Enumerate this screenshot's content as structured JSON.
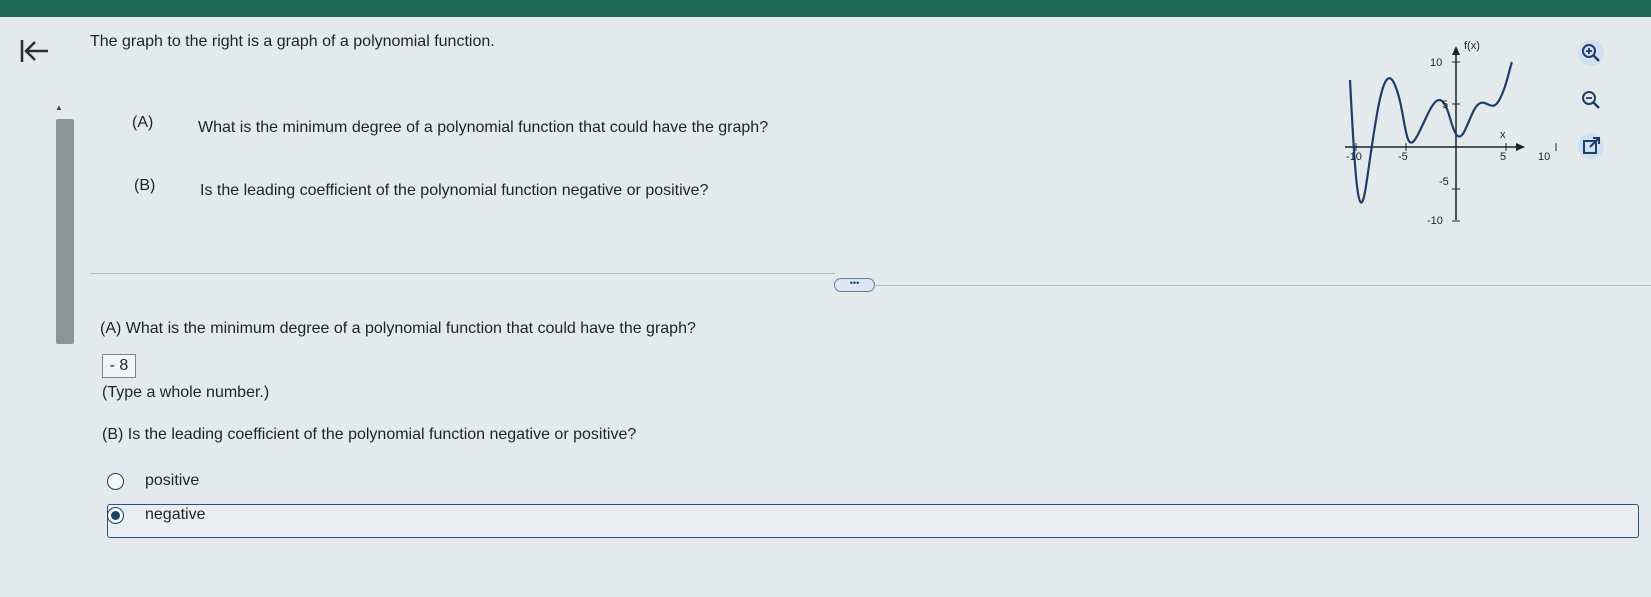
{
  "question": {
    "intro": "The graph to the right is a graph of a polynomial function.",
    "part_a_label": "(A)",
    "part_a_text": "What is the minimum degree of a polynomial function that could have the graph?",
    "part_b_label": "(B)",
    "part_b_text": "Is the leading coefficient of the polynomial function negative or positive?"
  },
  "graph": {
    "y_axis_label": "f(x)",
    "x_axis_label": "x",
    "y_ticks": [
      "10",
      "5",
      "-5",
      "-10"
    ],
    "x_ticks": [
      "-10",
      "-5",
      "5",
      "10"
    ]
  },
  "answers": {
    "a_prompt": "(A) What is the minimum degree of a polynomial function that could have the graph?",
    "a_value": "- 8",
    "a_hint": "(Type a whole number.)",
    "b_prompt": "(B) Is the leading coefficient of the polynomial function negative or positive?",
    "options": [
      "positive",
      "negative"
    ],
    "selected": "negative"
  },
  "icons": {
    "back": "back-arrow-icon",
    "zoom_in": "zoom-in-icon",
    "zoom_out": "zoom-out-icon",
    "popout": "popout-icon"
  },
  "colors": {
    "accent": "#1f3e67",
    "topbar": "#1f6a52",
    "background": "#e4e9ec"
  }
}
